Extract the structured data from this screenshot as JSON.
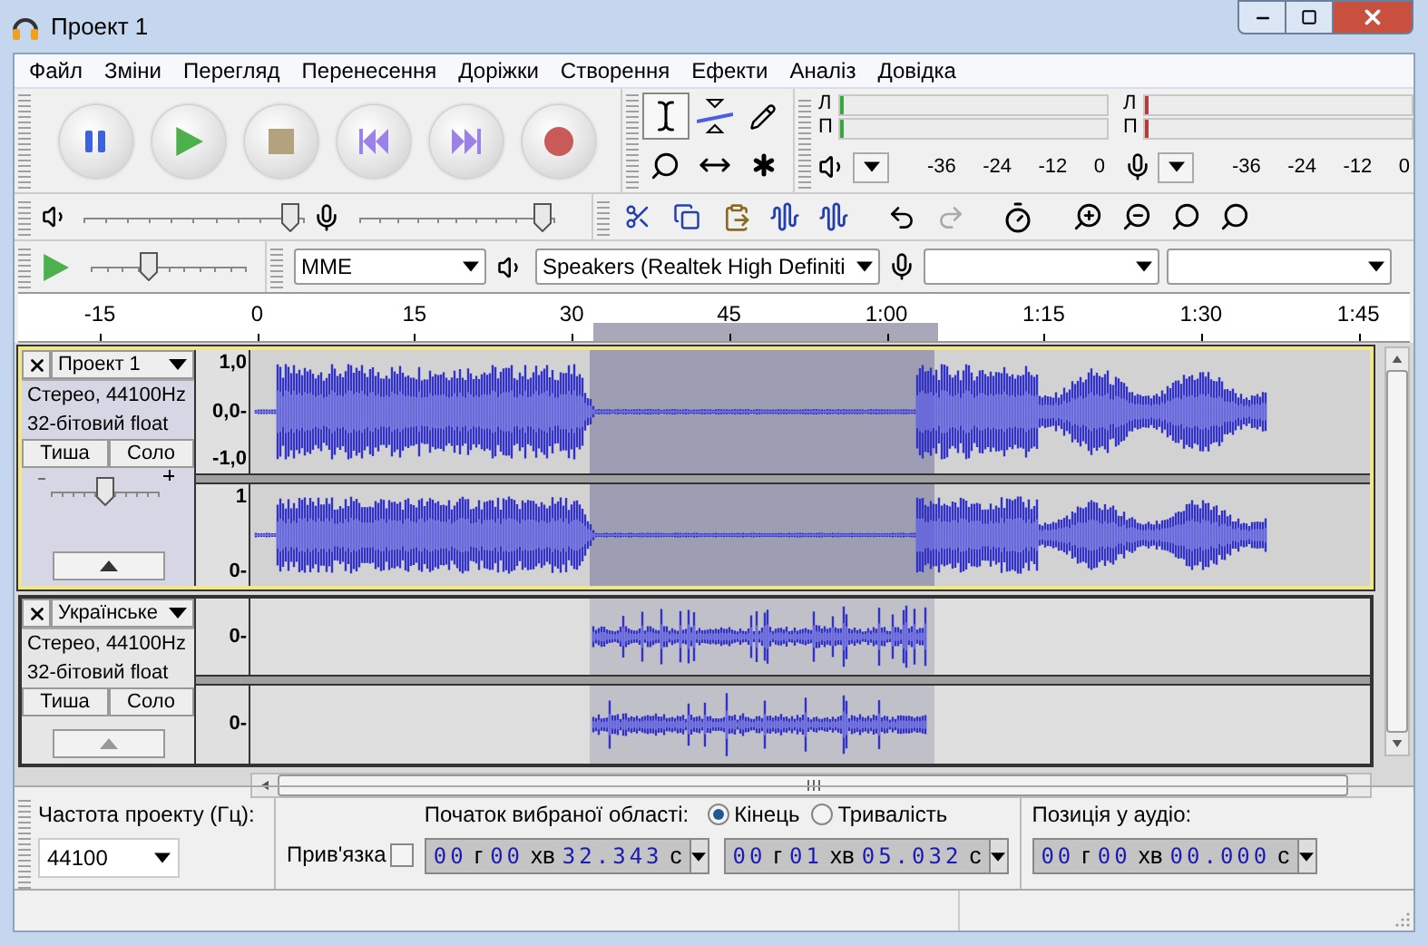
{
  "window": {
    "title": "Проект 1"
  },
  "menu": [
    "Файл",
    "Зміни",
    "Перегляд",
    "Перенесення",
    "Доріжки",
    "Створення",
    "Ефекти",
    "Аналіз",
    "Довідка"
  ],
  "transport": [
    {
      "kind": "pause"
    },
    {
      "kind": "play"
    },
    {
      "kind": "stop"
    },
    {
      "kind": "start"
    },
    {
      "kind": "end"
    },
    {
      "kind": "record"
    }
  ],
  "tools": [
    {
      "kind": "select",
      "selected": true
    },
    {
      "kind": "envelope",
      "selected": false
    },
    {
      "kind": "draw",
      "selected": false
    },
    {
      "kind": "zoom",
      "selected": false
    },
    {
      "kind": "timeshift",
      "selected": false
    },
    {
      "kind": "multi",
      "selected": false
    }
  ],
  "meters": [
    {
      "kind": "playback",
      "channels": [
        "Л",
        "П"
      ],
      "scale": [
        "-36",
        "-24",
        "-12",
        "0"
      ]
    },
    {
      "kind": "recording",
      "channels": [
        "Л",
        "П"
      ],
      "scale": [
        "-36",
        "-24",
        "-12",
        "0"
      ]
    }
  ],
  "mixer": {
    "output": {
      "level": 0.97
    },
    "input": {
      "level": 0.98
    }
  },
  "play_at_speed": {
    "level": 0.35
  },
  "devices": {
    "host": "MME",
    "output": "Speakers (Realtek High Definiti"
  },
  "ruler": [
    "-15",
    "0",
    "15",
    "30",
    "45",
    "1:00",
    "1:15",
    "1:30",
    "1:45"
  ],
  "tracks": [
    {
      "name": "Проект 1",
      "kind": "song",
      "selected": true,
      "info": [
        "Стерео, 44100Hz",
        "32-бітовий float"
      ],
      "mute": "Тиша",
      "solo": "Соло",
      "gain": {
        "level": 0.5
      },
      "channels": [
        {
          "scale": [
            "1,0",
            "0,0-",
            "-1,0"
          ]
        },
        {
          "scale": [
            "1",
            "0-"
          ]
        }
      ]
    },
    {
      "name": "Українське",
      "kind": "speech",
      "selected": false,
      "info": [
        "Стерео, 44100Hz",
        "32-бітовий float"
      ],
      "mute": "Тиша",
      "solo": "Соло",
      "channels": [
        {
          "scale": [
            "0-"
          ]
        },
        {
          "scale": [
            "0-"
          ]
        }
      ]
    }
  ],
  "selection_bar": {
    "rate_label": "Частота проекту (Гц):",
    "rate": "44100",
    "snap": {
      "label": "Прив'язка",
      "checked": false
    },
    "start_label": "Початок вибраної області:",
    "end_modes": [
      {
        "label": "Кінець",
        "selected": true
      },
      {
        "label": "Тривалість",
        "selected": false
      }
    ],
    "position_label": "Позиція у аудіо:",
    "times": [
      [
        "00",
        "г",
        "00",
        "хв",
        "32.343",
        "с"
      ],
      [
        "00",
        "г",
        "01",
        "хв",
        "05.032",
        "с"
      ],
      [
        "00",
        "г",
        "00",
        "хв",
        "00.000",
        "с"
      ]
    ]
  }
}
